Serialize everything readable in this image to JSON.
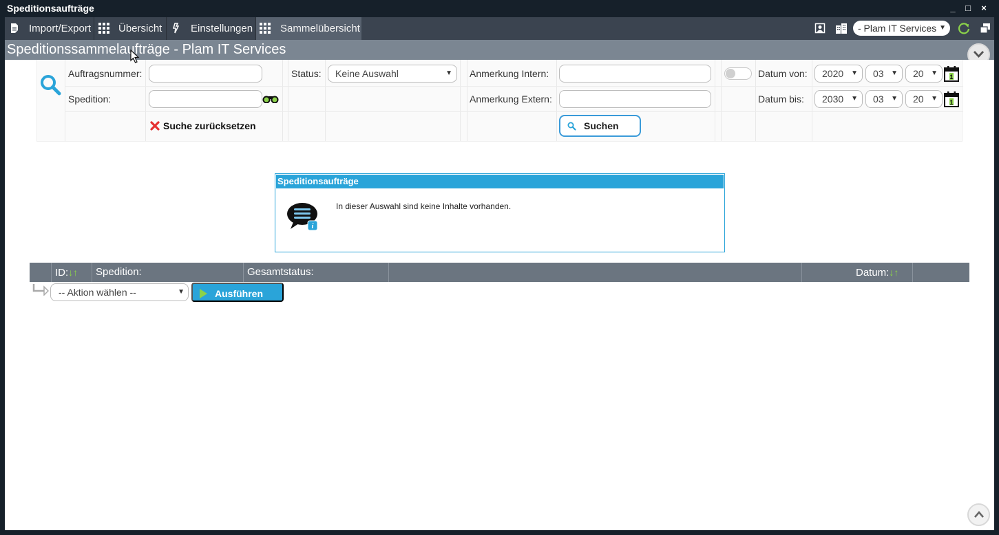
{
  "window": {
    "title": "Speditionsaufträge",
    "controls": {
      "minimize": "_",
      "maximize": "□",
      "close": "×"
    }
  },
  "toolbar": {
    "items": [
      {
        "label": "Import/Export",
        "icon": "document-icon"
      },
      {
        "label": "Übersicht",
        "icon": "grid-icon"
      },
      {
        "label": "Einstellungen",
        "icon": "settings-icon"
      },
      {
        "label": "Sammelübersicht",
        "icon": "grid-icon",
        "active": true
      }
    ],
    "company_select": "- Plam IT Services",
    "icons": [
      "user-profile-icon",
      "buildings-icon",
      "refresh-icon",
      "windows-icon"
    ]
  },
  "page": {
    "title": "Speditionssammelaufträge - Plam IT Services"
  },
  "filter": {
    "auftragsnummer_label": "Auftragsnummer:",
    "auftragsnummer_value": "",
    "spedition_label": "Spedition:",
    "spedition_value": "",
    "status_label": "Status:",
    "status_value": "Keine Auswahl",
    "anmerkung_intern_label": "Anmerkung Intern:",
    "anmerkung_intern_value": "",
    "anmerkung_extern_label": "Anmerkung Extern:",
    "anmerkung_extern_value": "",
    "datum_von_label": "Datum von:",
    "datum_von": {
      "year": "2020",
      "month": "03",
      "day": "20"
    },
    "datum_bis_label": "Datum bis:",
    "datum_bis": {
      "year": "2030",
      "month": "03",
      "day": "20"
    },
    "reset_label": "Suche zurücksetzen",
    "search_label": "Suchen",
    "toggle_on": false
  },
  "message": {
    "title": "Speditionsaufträge",
    "text": "In dieser Auswahl sind keine Inhalte vorhanden."
  },
  "table": {
    "columns": [
      "ID:",
      "Spedition:",
      "Gesamtstatus:",
      "",
      "Datum:"
    ]
  },
  "actions": {
    "select_value": "-- Aktion wählen --",
    "run_label": "Ausführen"
  },
  "colors": {
    "accent": "#2aa4d9",
    "toolbar": "#3b4450",
    "header": "#7b8692",
    "table_header": "#6b7580",
    "green": "#8bd24a"
  }
}
